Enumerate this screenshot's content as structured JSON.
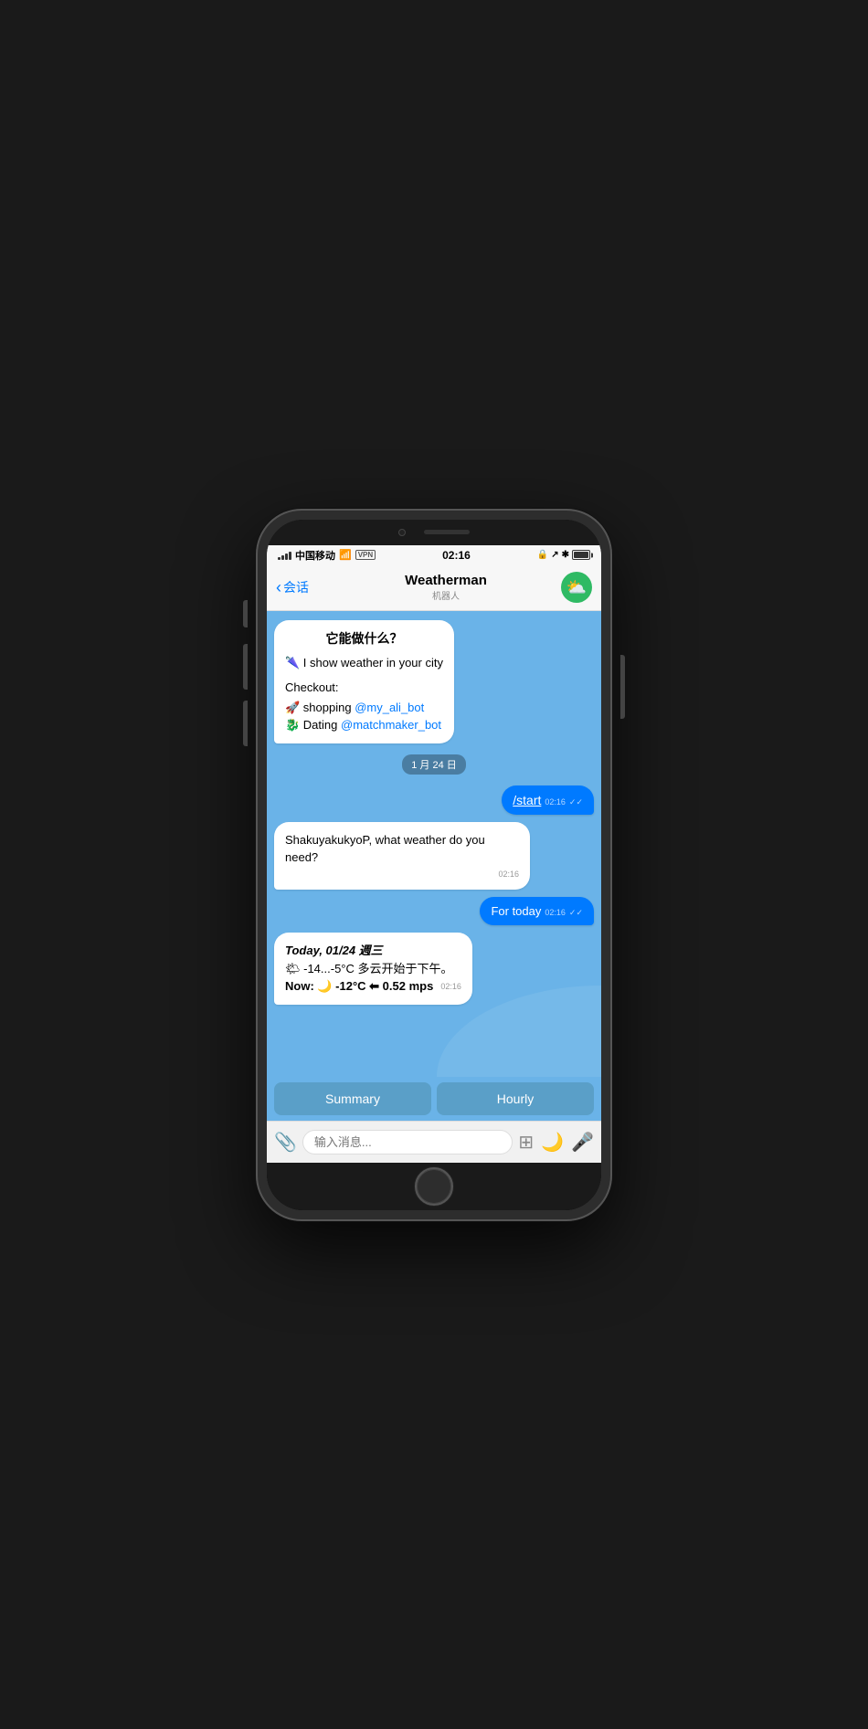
{
  "phone": {
    "status_bar": {
      "carrier": "中国移动",
      "time": "02:16",
      "wifi": "WiFi",
      "vpn": "VPN"
    },
    "nav": {
      "back_label": "会话",
      "title": "Weatherman",
      "subtitle": "机器人",
      "avatar_emoji": "⛅"
    },
    "chat": {
      "bot_intro_title": "它能做什么？",
      "bot_intro_line1": "🌂 I show weather in your city",
      "bot_intro_checkout": "Checkout:",
      "bot_intro_shopping_prefix": "🚀 shopping ",
      "bot_intro_shopping_link": "@my_ali_bot",
      "bot_intro_dating_prefix": "🐉 Dating ",
      "bot_intro_dating_link": "@matchmaker_bot",
      "date_badge": "1 月 24 日",
      "user_msg1_text": "/start",
      "user_msg1_time": "02:16",
      "bot_reply1_text": "ShakuyakukyoP, what weather do you need?",
      "bot_reply1_time": "02:16",
      "user_msg2_text": "For today",
      "user_msg2_time": "02:16",
      "bot_reply2_line1": "Today, 01/24 週三",
      "bot_reply2_line2": "🌤 -14...-5°C 多云开始于下午。",
      "bot_reply2_line3": "Now: 🌙 -12°C ⬅ 0.52 mps",
      "bot_reply2_time": "02:16",
      "btn_summary": "Summary",
      "btn_hourly": "Hourly"
    },
    "input": {
      "placeholder": "输入消息..."
    }
  }
}
